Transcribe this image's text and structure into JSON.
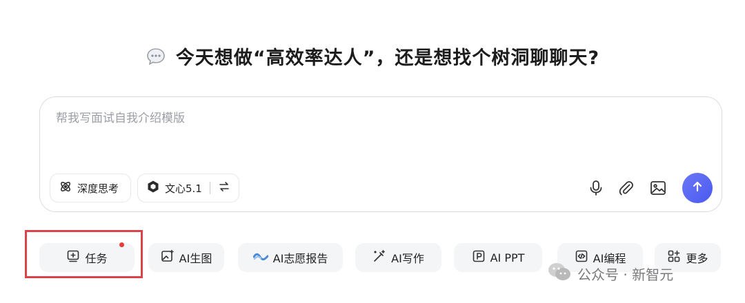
{
  "headline": {
    "text": "今天想做“高效率达人”，还是想找个树洞聊聊天?"
  },
  "composer": {
    "placeholder": "帮我写面试自我介绍模版",
    "deep_think_label": "深度思考",
    "model_label": "文心5.1"
  },
  "chips": [
    {
      "label": "任务",
      "icon": "task-icon",
      "has_dot": true
    },
    {
      "label": "AI生图",
      "icon": "image-gen-icon"
    },
    {
      "label": "AI志愿报告",
      "icon": "wave-icon"
    },
    {
      "label": "AI写作",
      "icon": "magic-pen-icon"
    },
    {
      "label": "AI PPT",
      "icon": "ppt-icon"
    },
    {
      "label": "AI编程",
      "icon": "code-icon"
    },
    {
      "label": "更多",
      "icon": "grid-plus-icon"
    }
  ],
  "watermark": {
    "text": "公众号 · 新智元"
  },
  "colors": {
    "accent": "#5563f2",
    "highlight": "#d9434a",
    "dot": "#e8393b"
  }
}
